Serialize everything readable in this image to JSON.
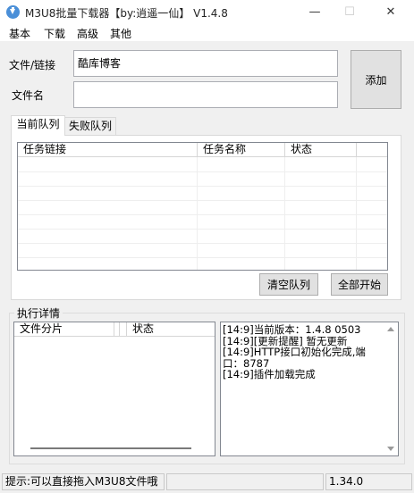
{
  "window": {
    "title": "M3U8批量下载器【by:逍遥一仙】 V1.4.8",
    "minimize_glyph": "—",
    "maximize_glyph": "☐",
    "close_glyph": "✕"
  },
  "menu": {
    "items": [
      "基本",
      "下载",
      "高级",
      "其他"
    ]
  },
  "form": {
    "file_link_label": "文件/链接",
    "file_link_value": "酷库博客",
    "file_name_label": "文件名",
    "file_name_value": "",
    "add_button": "添加"
  },
  "tabs": {
    "current_queue": "当前队列",
    "failed_queue": "失败队列"
  },
  "task_list": {
    "columns": [
      "任务链接",
      "任务名称",
      "状态"
    ],
    "rows": []
  },
  "queue_buttons": {
    "clear": "清空队列",
    "start_all": "全部开始"
  },
  "details": {
    "group_title": "执行详情",
    "segment_columns": [
      "文件分片",
      "",
      "状态"
    ],
    "log_lines": [
      "[14:9]当前版本：1.4.8 0503",
      "[14:9][更新提醒] 暂无更新",
      "[14:9]HTTP接口初始化完成,端口：8787",
      "[14:9]插件加载完成"
    ]
  },
  "status": {
    "hint": "提示:可以直接拖入M3U8文件哦",
    "middle": "",
    "version": "1.34.0"
  },
  "colors": {
    "accent_icon": "#4a8fd8",
    "window_bg": "#f0f0f0"
  }
}
